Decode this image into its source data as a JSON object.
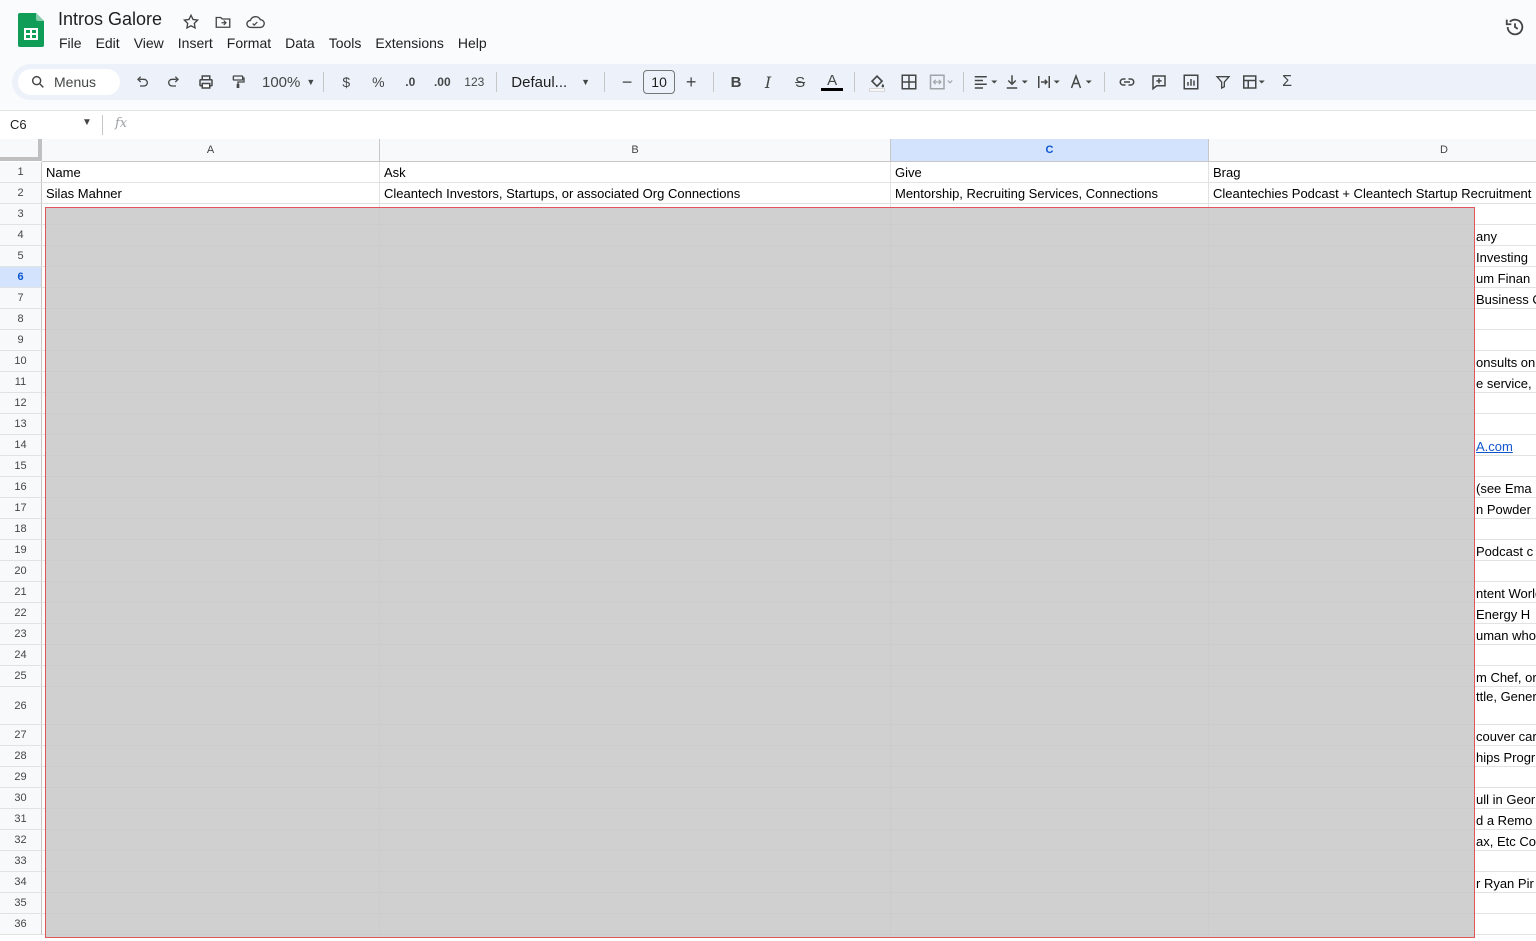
{
  "app": {
    "title": "Intros Galore",
    "menu": [
      "File",
      "Edit",
      "View",
      "Insert",
      "Format",
      "Data",
      "Tools",
      "Extensions",
      "Help"
    ]
  },
  "toolbar": {
    "search_label": "Menus",
    "zoom": "100%",
    "currency": "$",
    "percent": "%",
    "dec_decrease": ".0",
    "dec_increase": ".00",
    "number_format": "123",
    "font": "Defaul...",
    "font_size": "10",
    "minus": "−",
    "plus": "+",
    "bold": "B",
    "italic": "I",
    "strike": "S",
    "text_color": "A",
    "sum": "Σ"
  },
  "formula_bar": {
    "cell_ref": "C6",
    "fx": "fx",
    "value": ""
  },
  "sheet": {
    "columns": [
      "A",
      "B",
      "C",
      "D"
    ],
    "selected_column": "C",
    "selected_row": "6",
    "row_numbers": [
      "1",
      "2",
      "3",
      "4",
      "5",
      "6",
      "7",
      "8",
      "9",
      "10",
      "11",
      "12",
      "13",
      "14",
      "15",
      "16",
      "17",
      "18",
      "19",
      "20",
      "21",
      "22",
      "23",
      "24",
      "25",
      "26",
      "27",
      "28",
      "29",
      "30",
      "31",
      "32",
      "33",
      "34",
      "35",
      "36"
    ],
    "header": [
      "Name",
      "Ask",
      "Give",
      "Brag"
    ],
    "row2": [
      "Silas Mahner",
      "Cleantech Investors, Startups, or associated Org Connections",
      "Mentorship, Recruiting Services, Connections",
      "Cleantechies Podcast + Cleantech Startup Recruitment"
    ],
    "visible_fragments": [
      {
        "row": 4,
        "text": "any"
      },
      {
        "row": 5,
        "text": "Investing"
      },
      {
        "row": 6,
        "text": "um Finan"
      },
      {
        "row": 7,
        "text": "Business Ow"
      },
      {
        "row": 10,
        "text": "onsults on"
      },
      {
        "row": 11,
        "text": "e service, I"
      },
      {
        "row": 14,
        "text": "A.com",
        "link": true
      },
      {
        "row": 16,
        "text": "(see Ema"
      },
      {
        "row": 17,
        "text": "n Powder"
      },
      {
        "row": 19,
        "text": "Podcast c"
      },
      {
        "row": 21,
        "text": "ntent World"
      },
      {
        "row": 22,
        "text": "Energy H"
      },
      {
        "row": 23,
        "text": "uman who"
      },
      {
        "row": 25,
        "text": "m Chef, or"
      },
      {
        "row": 26,
        "text": "ttle, Gener"
      },
      {
        "row": 27,
        "text": "couver car"
      },
      {
        "row": 28,
        "text": "hips Progr"
      },
      {
        "row": 30,
        "text": "ull in Geor"
      },
      {
        "row": 31,
        "text": "d a Remo"
      },
      {
        "row": 32,
        "text": "ax, Etc Cor"
      },
      {
        "row": 34,
        "text": "r Ryan Pir"
      }
    ]
  },
  "colors": {
    "accent": "#0b57d0",
    "selection_header": "#d3e3fd",
    "redaction": "#c8c8ca",
    "redaction_border": "#e0555e",
    "link": "#1155cc"
  }
}
